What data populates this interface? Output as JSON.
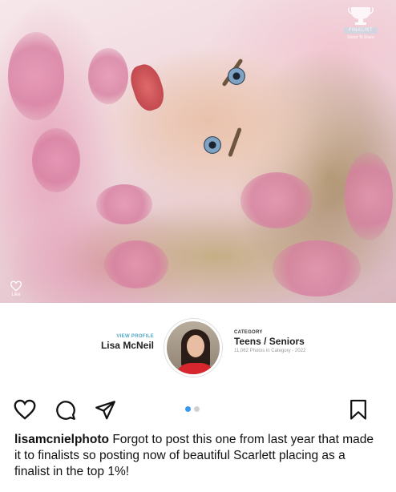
{
  "photo": {
    "badge": {
      "ribbon": "FINALIST",
      "sub": "Shoot 'N Share"
    },
    "like_label": "Like"
  },
  "profile": {
    "view_profile": "VIEW PROFILE",
    "name": "Lisa McNeil",
    "category_label": "CATEGORY",
    "category_name": "Teens / Seniors",
    "category_meta": "11,062 Photos in Category - 2022"
  },
  "actions": {
    "icons": [
      "heart-icon",
      "comment-icon",
      "share-icon",
      "bookmark-icon"
    ],
    "carousel": {
      "count": 2,
      "active": 1
    },
    "accent": "#3897f0"
  },
  "caption": {
    "username": "lisamcnielphoto",
    "text": "Forgot to post this one from last year that made it to finalists so posting now of beautiful Scarlett placing as a finalist in the top 1%!"
  }
}
